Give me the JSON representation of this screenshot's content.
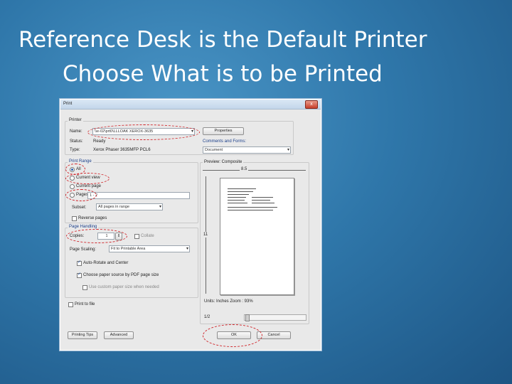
{
  "slide": {
    "title_line1": "Reference Desk is the Default Printer",
    "title_line2": "Choose What is to be Printed"
  },
  "dialog": {
    "title": "Print",
    "close_label": "x",
    "printer": {
      "section_label": "Printer",
      "name_label": "Name:",
      "name_value": "\\\\e-02\\prt0\\LLLOAK XEROX-3635",
      "status_label": "Status:",
      "status_value": "Ready",
      "type_label": "Type:",
      "type_value": "Xerox Phaser 3635MFP PCL6",
      "properties_label": "Properties",
      "comments_label": "Comments and Forms:",
      "comments_value": "Document"
    },
    "print_range": {
      "section_label": "Print Range",
      "all_label": "All",
      "current_view_label": "Current view",
      "current_page_label": "Current page",
      "pages_label": "Pages",
      "pages_value": "1 - 2",
      "subset_label": "Subset:",
      "subset_value": "All pages in range",
      "reverse_label": "Reverse pages"
    },
    "page_handling": {
      "section_label": "Page Handling",
      "copies_label": "Copies:",
      "copies_value": "1",
      "collate_label": "Collate",
      "scaling_label": "Page Scaling:",
      "scaling_value": "Fit to Printable Area",
      "auto_rotate_label": "Auto-Rotate and Center",
      "paper_source_label": "Choose paper source by PDF page size",
      "custom_paper_label": "Use custom paper size when needed"
    },
    "print_to_file_label": "Print to file",
    "preview": {
      "section_label": "Preview: Composite",
      "width_label": "8.5",
      "height_label": "11",
      "units_label": "Units: Inches Zoom : 93%",
      "page_indicator": "1/2"
    },
    "buttons": {
      "tips": "Printing Tips",
      "advanced": "Advanced",
      "ok": "OK",
      "cancel": "Cancel"
    }
  }
}
